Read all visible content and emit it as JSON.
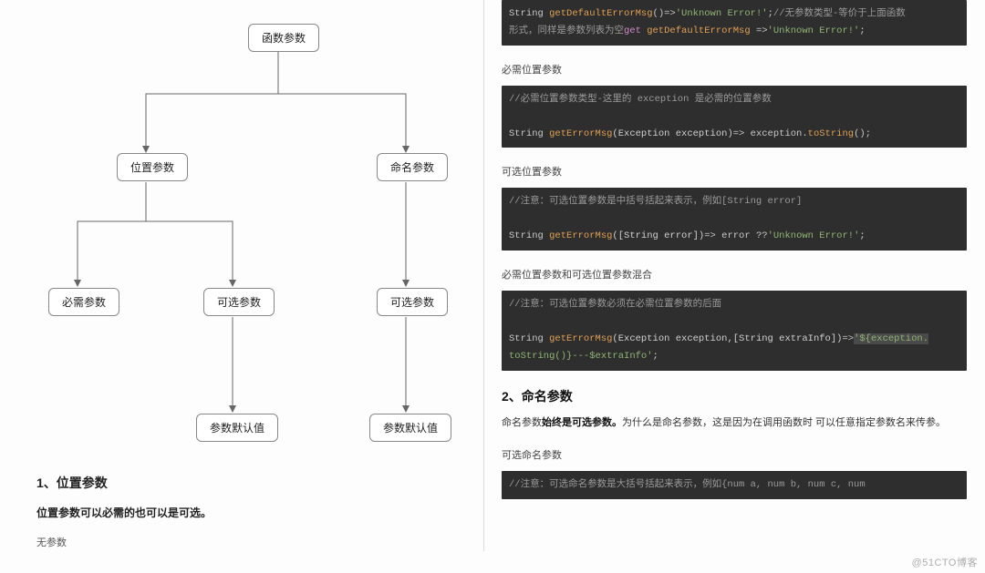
{
  "flow": {
    "root": "函数参数",
    "pos": "位置参数",
    "named": "命名参数",
    "req": "必需参数",
    "opt1": "可选参数",
    "opt2": "可选参数",
    "def1": "参数默认值",
    "def2": "参数默认值"
  },
  "left": {
    "h1": "1、位置参数",
    "b1": "位置参数可以必需的也可以是可选。",
    "p1": "无参数"
  },
  "right": {
    "code1_l1_pre": "String ",
    "code1_l1_fn": "getDefaultErrorMsg",
    "code1_l1_mid": "()=>",
    "code1_l1_str": "'Unknown Error!'",
    "code1_l1_post": ";",
    "code1_l1_cm": "//无参数类型-等价于上面函数",
    "code1_l2_cm": "形式，同样是参数列表为空",
    "code1_l2_kw": "get",
    "code1_l2_fn": " getDefaultErrorMsg ",
    "code1_l2_op": "=>",
    "code1_l2_str": "'Unknown Error!'",
    "code1_l2_post": ";",
    "sub1": "必需位置参数",
    "code2_cm": "//必需位置参数类型-这里的 exception 是必需的位置参数",
    "code2_pre": "String ",
    "code2_fn": "getErrorMsg",
    "code2_args": "(Exception exception)",
    "code2_op": "=> exception.",
    "code2_call": "toString",
    "code2_end": "();",
    "sub2": "可选位置参数",
    "code3_cm": "//注意：可选位置参数是中括号括起来表示，例如[String error]",
    "code3_pre": "String ",
    "code3_fn": "getErrorMsg",
    "code3_args": "([String error])",
    "code3_mid": "=> error ??",
    "code3_str": "'Unknown Error!'",
    "code3_end": ";",
    "sub3": "必需位置参数和可选位置参数混合",
    "code4_cm": "//注意：可选位置参数必须在必需位置参数的后面",
    "code4_pre": "String ",
    "code4_fn": "getErrorMsg",
    "code4_args": "(Exception exception,[String extraInfo])",
    "code4_op": "=>",
    "code4_str1": "'${exception.",
    "code4_str2": "toString()}---$extraInfo'",
    "code4_end": ";",
    "h2": "2、命名参数",
    "para_a": "命名参数",
    "para_strong": "始终是可选参数。",
    "para_b": "为什么是命名参数，这是因为在调用函数时 可以任意指定参数名来传参。",
    "sub4": "可选命名参数",
    "code5_cm": "//注意：可选命名参数是大括号括起来表示，例如{num a, num b, num c, num"
  },
  "watermark": "@51CTO博客"
}
